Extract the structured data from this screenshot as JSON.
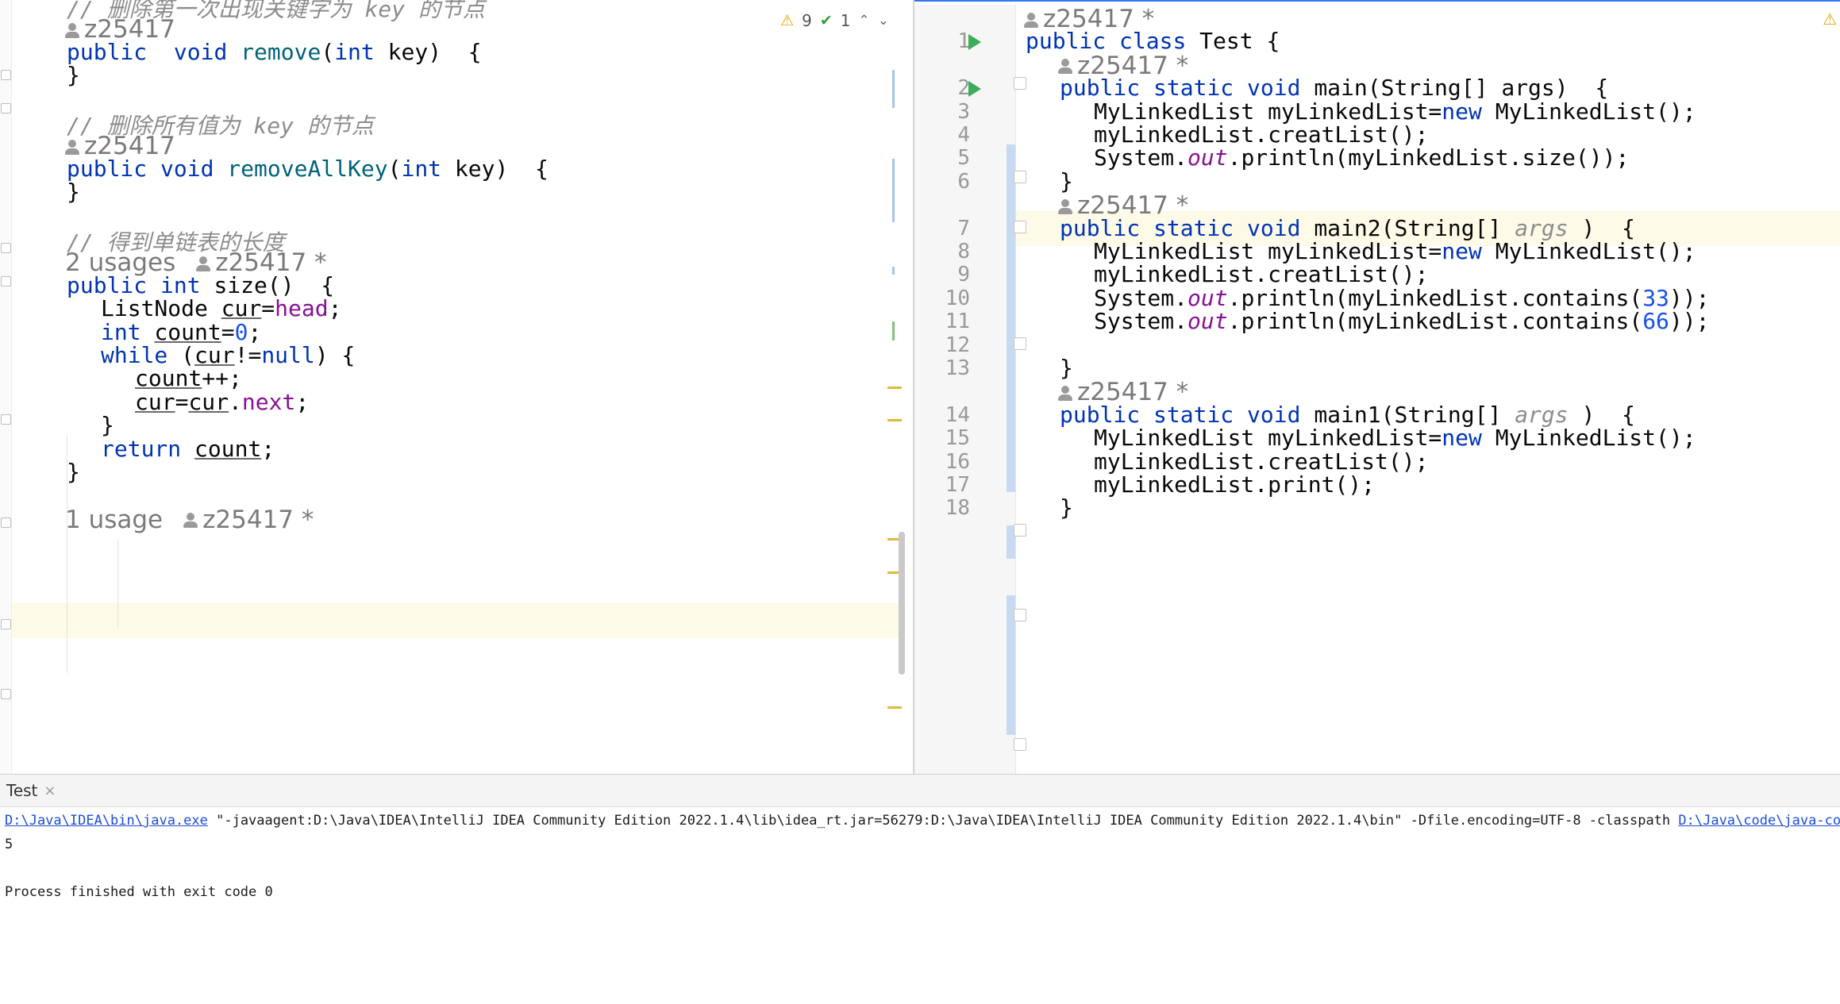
{
  "left_editor": {
    "lines": [
      {
        "kind": "comment",
        "text": "// 删除第一次出现关键字为 key 的节点"
      },
      {
        "kind": "hint",
        "author": "z25417"
      },
      {
        "kind": "code",
        "indent": 0,
        "tokens": [
          [
            "kw",
            "public"
          ],
          [
            "",
            "  "
          ],
          [
            "kw",
            "void"
          ],
          [
            "",
            ""
          ],
          [
            "fn",
            " remove"
          ],
          [
            "",
            "("
          ],
          [
            "kw",
            "int"
          ],
          [
            "",
            " key)  {"
          ]
        ]
      },
      {
        "kind": "code",
        "indent": 0,
        "tokens": [
          [
            "",
            "}"
          ]
        ]
      },
      {
        "kind": "blank"
      },
      {
        "kind": "comment",
        "text": "// 删除所有值为 key 的节点"
      },
      {
        "kind": "hint",
        "author": "z25417"
      },
      {
        "kind": "code",
        "indent": 0,
        "tokens": [
          [
            "kw",
            "public"
          ],
          [
            "",
            " "
          ],
          [
            "kw",
            "void"
          ],
          [
            "fn",
            " removeAllKey"
          ],
          [
            "",
            "("
          ],
          [
            "kw",
            "int"
          ],
          [
            "",
            " key)  {"
          ]
        ]
      },
      {
        "kind": "code",
        "indent": 0,
        "tokens": [
          [
            "",
            "}"
          ]
        ]
      },
      {
        "kind": "blank"
      },
      {
        "kind": "comment",
        "text": "// 得到单链表的长度"
      },
      {
        "kind": "hint",
        "usages": "2 usages",
        "author": "z25417 *"
      },
      {
        "kind": "code",
        "indent": 0,
        "tokens": [
          [
            "kw",
            "public"
          ],
          [
            "",
            " "
          ],
          [
            "kw",
            "int"
          ],
          [
            "",
            " size()  {"
          ]
        ]
      },
      {
        "kind": "code",
        "indent": 1,
        "tokens": [
          [
            "",
            "ListNode "
          ],
          [
            "ul",
            "cur"
          ],
          [
            "",
            "="
          ],
          [
            "fld",
            "head"
          ],
          [
            "",
            ";"
          ]
        ]
      },
      {
        "kind": "code",
        "indent": 1,
        "tokens": [
          [
            "kw",
            "int"
          ],
          [
            "",
            " "
          ],
          [
            "ul",
            "count"
          ],
          [
            "",
            "="
          ],
          [
            "num",
            "0"
          ],
          [
            "",
            ";"
          ]
        ]
      },
      {
        "kind": "code",
        "indent": 1,
        "tokens": [
          [
            "kw",
            "while"
          ],
          [
            "",
            " ("
          ],
          [
            "ul",
            "cur"
          ],
          [
            "",
            "!="
          ],
          [
            "kw",
            "null"
          ],
          [
            "",
            ") {"
          ]
        ]
      },
      {
        "kind": "code",
        "indent": 2,
        "tokens": [
          [
            "ul",
            "count"
          ],
          [
            "",
            "++;"
          ]
        ]
      },
      {
        "kind": "code",
        "indent": 2,
        "tokens": [
          [
            "ul",
            "cur"
          ],
          [
            "",
            "="
          ],
          [
            "ul",
            "cur"
          ],
          [
            "",
            "."
          ],
          [
            "fld",
            "next"
          ],
          [
            "",
            ";"
          ]
        ]
      },
      {
        "kind": "code",
        "indent": 1,
        "tokens": [
          [
            "",
            "}"
          ]
        ]
      },
      {
        "kind": "code",
        "indent": 1,
        "tokens": [
          [
            "kw",
            "return"
          ],
          [
            "",
            " "
          ],
          [
            "ul",
            "count"
          ],
          [
            "",
            ";"
          ]
        ]
      },
      {
        "kind": "code",
        "indent": 0,
        "tokens": [
          [
            "",
            "}"
          ]
        ]
      },
      {
        "kind": "blank"
      },
      {
        "kind": "hint",
        "usages": "1 usage",
        "author": "z25417 *"
      }
    ],
    "inspection": {
      "warnings": "9",
      "checks": "1"
    }
  },
  "right_editor": {
    "rows": [
      {
        "kind": "hint",
        "author": "z25417 *",
        "indent": 0
      },
      {
        "kind": "code",
        "num": "1",
        "run": true,
        "indent": 0,
        "tokens": [
          [
            "kw",
            "public"
          ],
          [
            "",
            " "
          ],
          [
            "kw",
            "class"
          ],
          [
            "",
            " Test {"
          ]
        ]
      },
      {
        "kind": "hint",
        "author": "z25417 *",
        "indent": 1
      },
      {
        "kind": "code",
        "num": "2",
        "run": true,
        "indent": 1,
        "tokens": [
          [
            "kw",
            "public"
          ],
          [
            "",
            " "
          ],
          [
            "kw",
            "static"
          ],
          [
            "",
            " "
          ],
          [
            "kw",
            "void"
          ],
          [
            "",
            " main(String[] args)  {"
          ]
        ]
      },
      {
        "kind": "code",
        "num": "3",
        "indent": 2,
        "tokens": [
          [
            "",
            "MyLinkedList myLinkedList="
          ],
          [
            "kw",
            "new"
          ],
          [
            "",
            " MyLinkedList();"
          ]
        ]
      },
      {
        "kind": "code",
        "num": "4",
        "indent": 2,
        "tokens": [
          [
            "",
            "myLinkedList.creatList();"
          ]
        ]
      },
      {
        "kind": "code",
        "num": "5",
        "indent": 2,
        "tokens": [
          [
            "",
            "System."
          ],
          [
            "sfld",
            "out"
          ],
          [
            "",
            ".println(myLinkedList.size());"
          ]
        ]
      },
      {
        "kind": "code",
        "num": "6",
        "indent": 1,
        "tokens": [
          [
            "",
            "}"
          ]
        ]
      },
      {
        "kind": "hint",
        "author": "z25417 *",
        "indent": 1
      },
      {
        "kind": "code",
        "num": "7",
        "indent": 1,
        "tokens": [
          [
            "kw",
            "public"
          ],
          [
            "",
            " "
          ],
          [
            "kw",
            "static"
          ],
          [
            "",
            " "
          ],
          [
            "kw",
            "void"
          ],
          [
            "",
            " main2(String[] "
          ],
          [
            "cm2",
            "args"
          ],
          [
            "",
            " )  {"
          ]
        ]
      },
      {
        "kind": "code",
        "num": "8",
        "indent": 2,
        "tokens": [
          [
            "",
            "MyLinkedList myLinkedList="
          ],
          [
            "kw",
            "new"
          ],
          [
            "",
            " MyLinkedList();"
          ]
        ]
      },
      {
        "kind": "code",
        "num": "9",
        "indent": 2,
        "tokens": [
          [
            "",
            "myLinkedList.creatList();"
          ]
        ]
      },
      {
        "kind": "code",
        "num": "10",
        "indent": 2,
        "tokens": [
          [
            "",
            "System."
          ],
          [
            "sfld",
            "out"
          ],
          [
            "",
            ".println(myLinkedList.contains("
          ],
          [
            "num",
            "33"
          ],
          [
            "",
            "));"
          ]
        ]
      },
      {
        "kind": "code",
        "num": "11",
        "indent": 2,
        "tokens": [
          [
            "",
            "System."
          ],
          [
            "sfld",
            "out"
          ],
          [
            "",
            ".println(myLinkedList.contains("
          ],
          [
            "num",
            "66"
          ],
          [
            "",
            "));"
          ]
        ]
      },
      {
        "kind": "code",
        "num": "12",
        "indent": 2,
        "tokens": []
      },
      {
        "kind": "code",
        "num": "13",
        "indent": 1,
        "tokens": [
          [
            "",
            "}"
          ]
        ]
      },
      {
        "kind": "hint",
        "author": "z25417 *",
        "indent": 1
      },
      {
        "kind": "code",
        "num": "14",
        "indent": 1,
        "tokens": [
          [
            "kw",
            "public"
          ],
          [
            "",
            " "
          ],
          [
            "kw",
            "static"
          ],
          [
            "",
            " "
          ],
          [
            "kw",
            "void"
          ],
          [
            "",
            " main1(String[] "
          ],
          [
            "cm2",
            "args"
          ],
          [
            "",
            " )  {"
          ]
        ]
      },
      {
        "kind": "code",
        "num": "15",
        "indent": 2,
        "tokens": [
          [
            "",
            "MyLinkedList myLinkedList="
          ],
          [
            "kw",
            "new"
          ],
          [
            "",
            " MyLinkedList();"
          ]
        ]
      },
      {
        "kind": "code",
        "num": "16",
        "indent": 2,
        "tokens": [
          [
            "",
            "myLinkedList.creatList();"
          ]
        ]
      },
      {
        "kind": "code",
        "num": "17",
        "indent": 2,
        "tokens": [
          [
            "",
            "myLinkedList.print();"
          ]
        ]
      },
      {
        "kind": "code",
        "num": "18",
        "indent": 1,
        "tokens": [
          [
            "",
            "}"
          ]
        ]
      }
    ]
  },
  "run_panel": {
    "tab_label": "Test",
    "command": {
      "java_exe": "D:\\Java\\IDEA\\bin\\java.exe",
      "args": " \"-javaagent:D:\\Java\\IDEA\\IntelliJ IDEA Community Edition 2022.1.4\\lib\\idea_rt.jar=56279:D:\\Java\\IDEA\\IntelliJ IDEA Community Edition 2022.1.4\\bin\" -Dfile.encoding=UTF-8 -classpath ",
      "classpath": "D:\\Java\\code\\java-code\\Li"
    },
    "output": "5",
    "exit_message": "Process finished with exit code 0"
  },
  "colors": {
    "keyword": "#0033b3",
    "number": "#1750eb",
    "field": "#871094",
    "comment": "#8c8c8c",
    "highlight": "#fdfbe7",
    "run": "#3bac57"
  }
}
